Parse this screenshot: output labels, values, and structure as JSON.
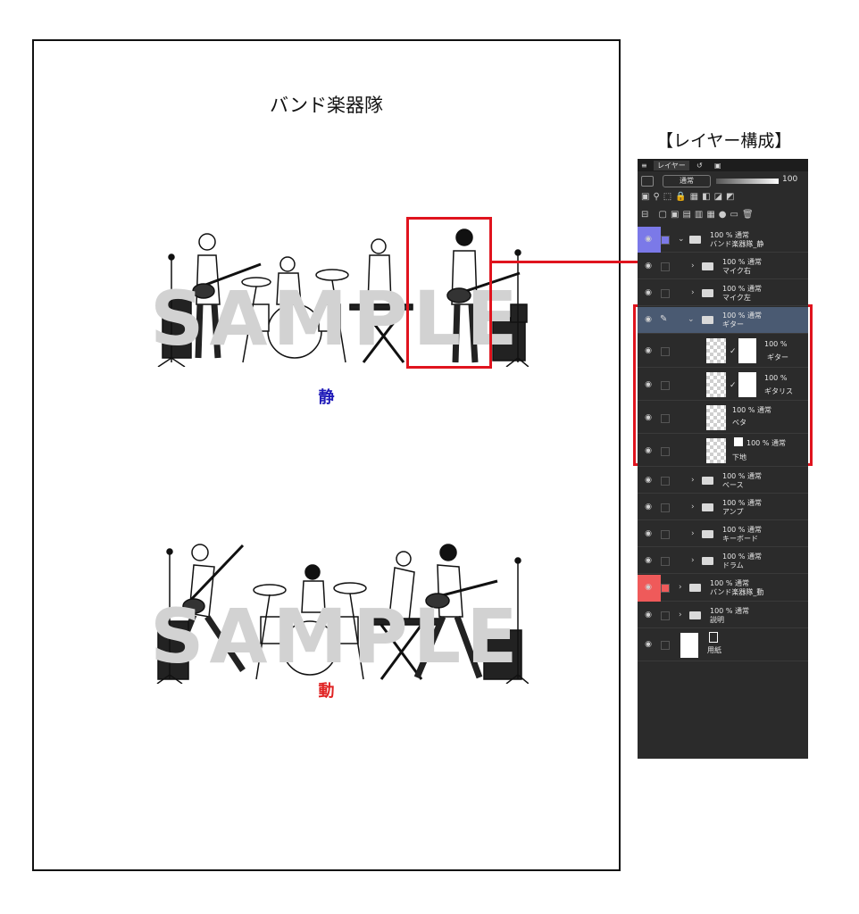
{
  "document": {
    "title": "バンド楽器隊",
    "watermark_calm": "SAMPLE",
    "watermark_motion": "SAMPLE",
    "caption_calm": "静",
    "caption_motion": "動"
  },
  "layer_panel": {
    "heading": "【レイヤー構成】",
    "tab_label": "レイヤー",
    "blend_mode": "通常",
    "opacity": "100",
    "layers": [
      {
        "name": "バンド楽器隊_静",
        "mode": "100 % 通常"
      },
      {
        "name": "マイク右",
        "mode": "100 % 通常"
      },
      {
        "name": "マイク左",
        "mode": "100 % 通常"
      },
      {
        "name": "ギター",
        "mode": "100 % 通常"
      },
      {
        "name": "ギター",
        "mode": "100 %"
      },
      {
        "name": "ギタリス",
        "mode": "100 %"
      },
      {
        "name": "ベタ",
        "mode": "100 % 通常"
      },
      {
        "name": "下地",
        "mode": "100 % 通常"
      },
      {
        "name": "ベース",
        "mode": "100 % 通常"
      },
      {
        "name": "アンプ",
        "mode": "100 % 通常"
      },
      {
        "name": "キーボード",
        "mode": "100 % 通常"
      },
      {
        "name": "ドラム",
        "mode": "100 % 通常"
      },
      {
        "name": "バンド楽器隊_動",
        "mode": "100 % 通常"
      },
      {
        "name": "説明",
        "mode": "100 % 通常"
      },
      {
        "name": "用紙",
        "mode": ""
      }
    ]
  },
  "colors": {
    "calm": "#1f1ab8",
    "motion": "#e02323",
    "highlight": "#e0141e",
    "calm_group": "#7b79e8",
    "motion_group": "#ef5a5a"
  }
}
